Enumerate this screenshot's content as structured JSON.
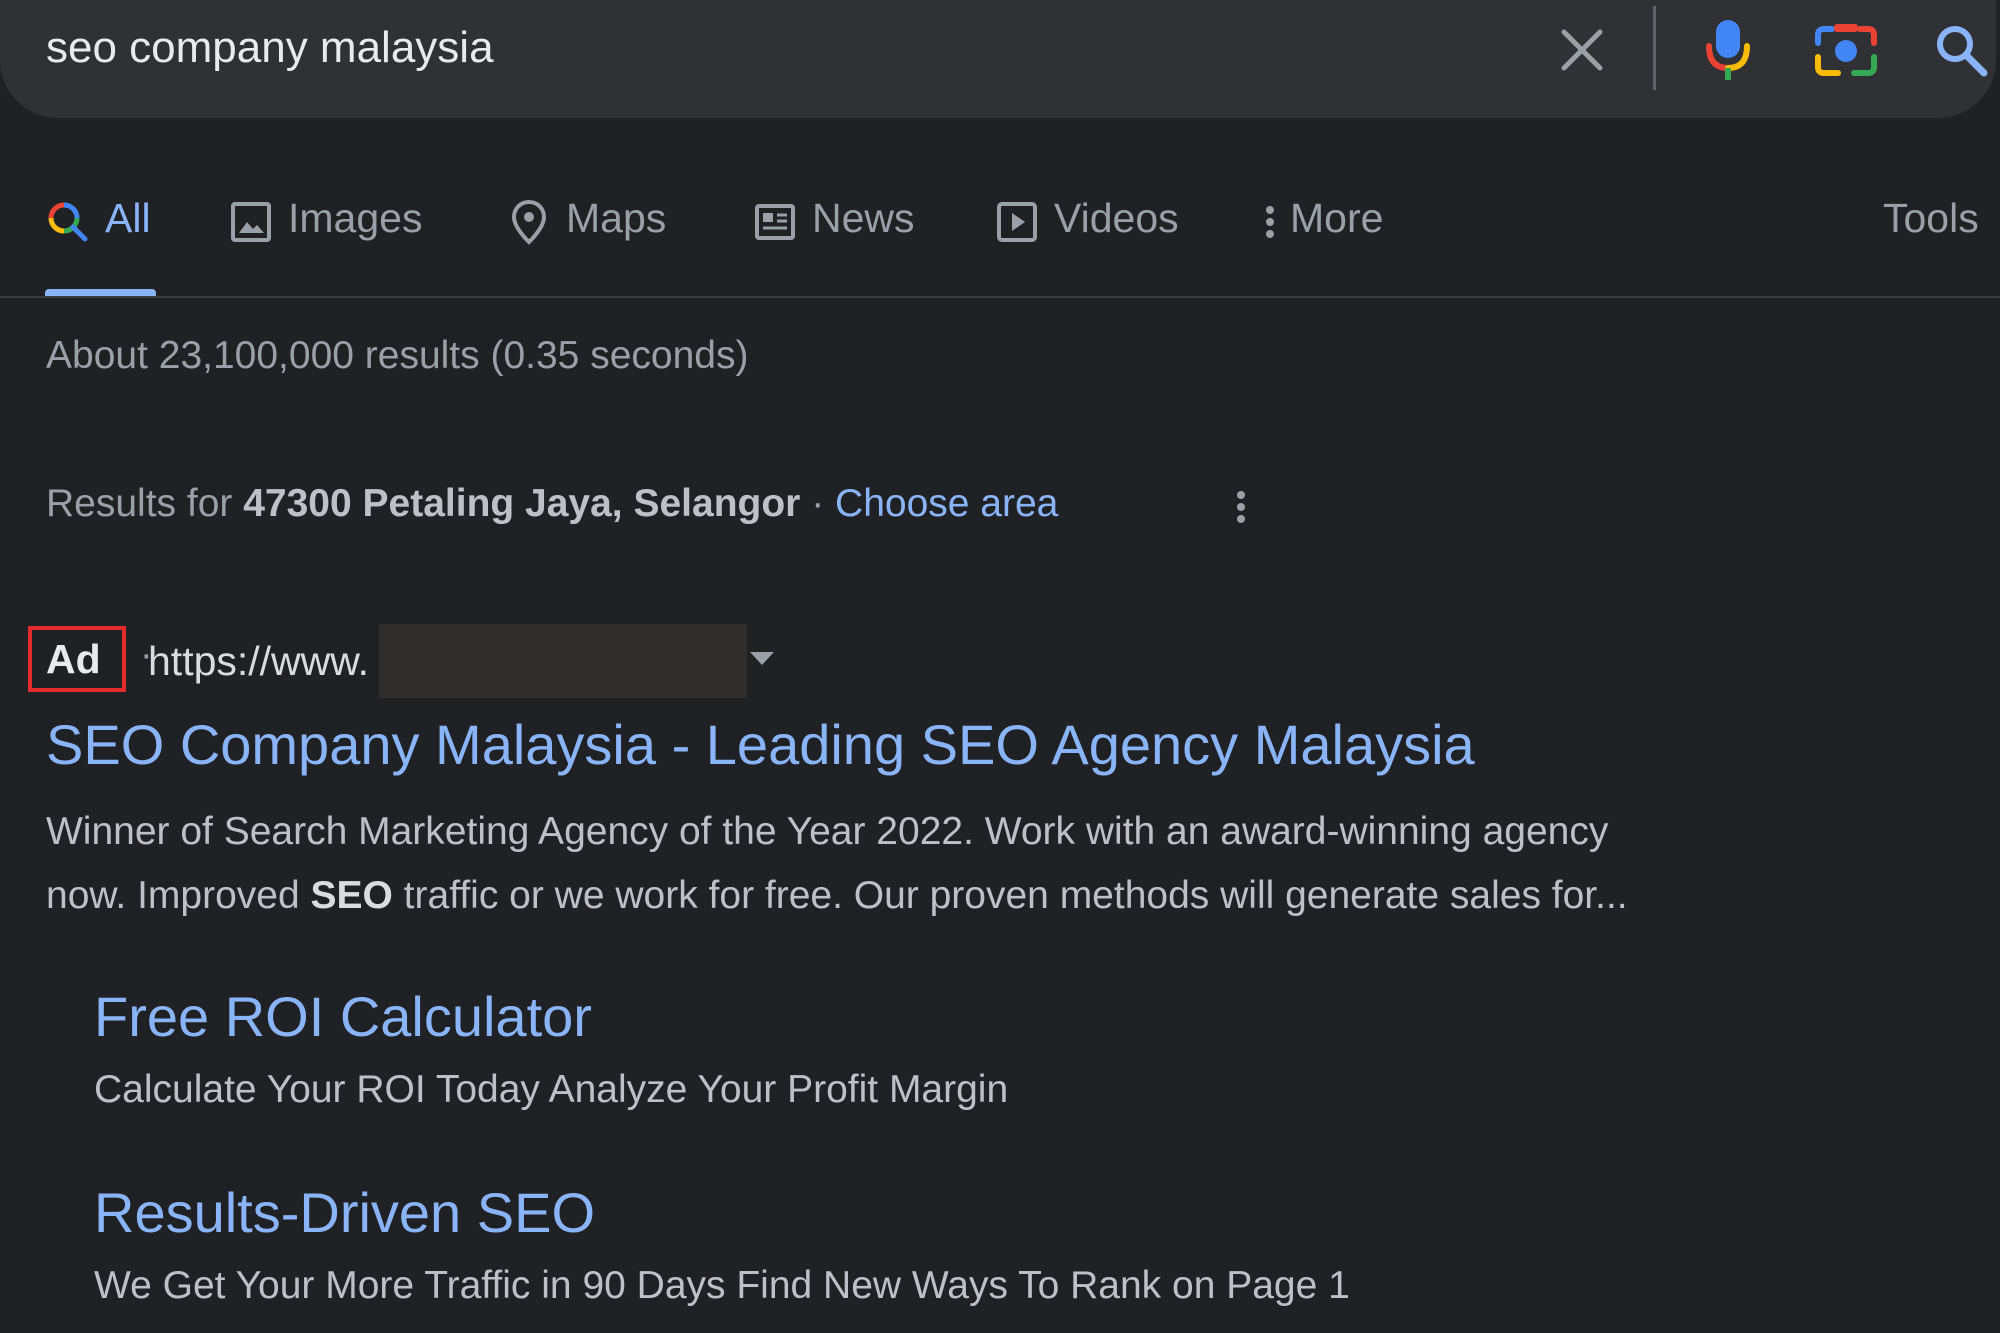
{
  "search": {
    "query": "seo company malaysia"
  },
  "icons": {
    "clear": "close-icon",
    "voice": "microphone-icon",
    "lens": "camera-icon",
    "search": "search-icon"
  },
  "colors": {
    "background": "#202124",
    "searchbar": "#303134",
    "link": "#8ab4f8",
    "highlight_box": "#e32b2b"
  },
  "tabs": [
    {
      "label": "All",
      "icon": "search-icon",
      "active": true
    },
    {
      "label": "Images",
      "icon": "image-icon"
    },
    {
      "label": "Maps",
      "icon": "map-pin-icon"
    },
    {
      "label": "News",
      "icon": "newspaper-icon"
    },
    {
      "label": "Videos",
      "icon": "play-icon"
    },
    {
      "label": "More",
      "icon": "more-vert-icon"
    }
  ],
  "tools_label": "Tools",
  "stats": "About 23,100,000 results (0.35 seconds)",
  "location": {
    "prefix": "Results for ",
    "place": "47300 Petaling Jaya, Selangor",
    "separator": " · ",
    "choose_area": "Choose area"
  },
  "ad": {
    "badge": "Ad",
    "dot": "·",
    "url": "https://www.",
    "title": "SEO Company Malaysia - Leading SEO Agency Malaysia",
    "desc_line1": "Winner of Search Marketing Agency of the Year 2022. Work with an award-winning agency",
    "desc_prefix": "now. Improved ",
    "desc_bold": "SEO",
    "desc_suffix": " traffic or we work for free. Our proven methods will generate sales for...",
    "sitelinks": [
      {
        "title": "Free ROI Calculator",
        "desc": "Calculate Your ROI Today Analyze Your Profit Margin"
      },
      {
        "title": "Results-Driven SEO",
        "desc": "We Get Your More Traffic in 90 Days Find New Ways To Rank on Page 1"
      }
    ]
  }
}
